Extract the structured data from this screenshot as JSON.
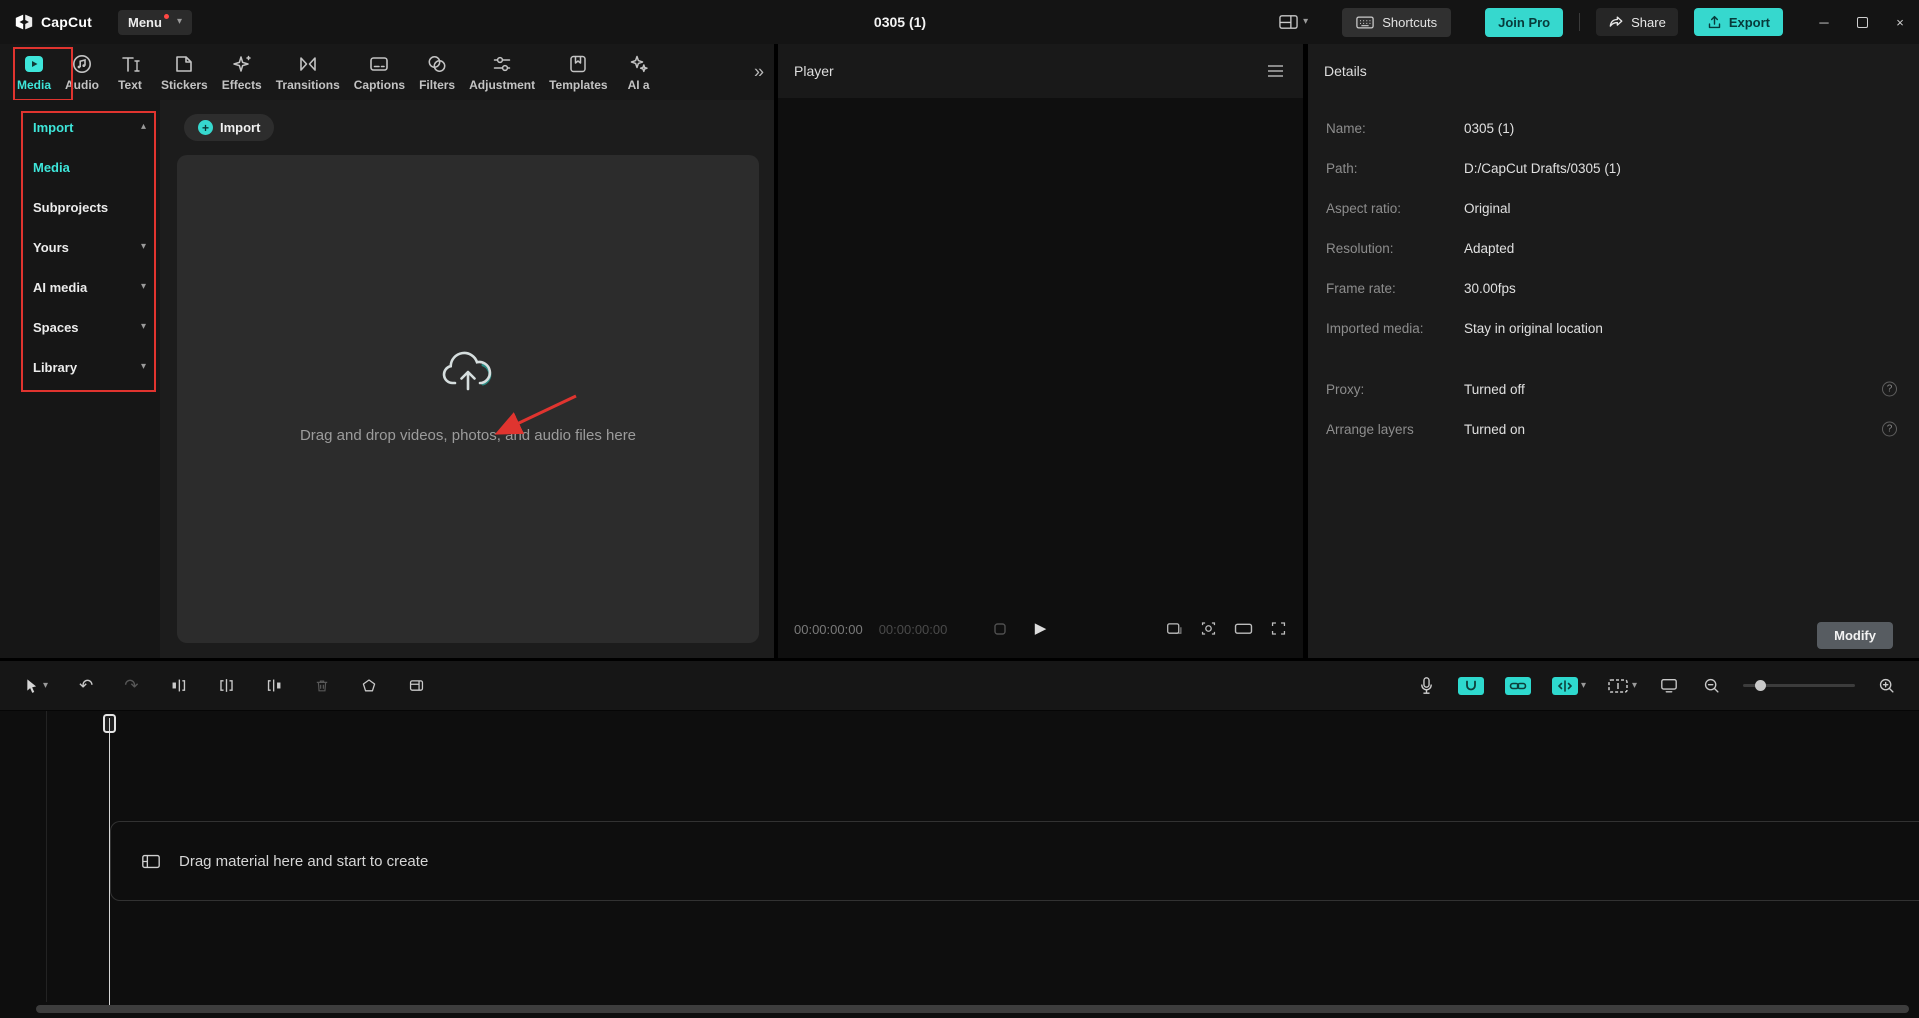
{
  "titlebar": {
    "logo_text": "CapCut",
    "menu_label": "Menu",
    "project_title": "0305 (1)",
    "shortcuts_label": "Shortcuts",
    "join_pro_label": "Join Pro",
    "share_label": "Share",
    "export_label": "Export"
  },
  "media_panel": {
    "tabs": [
      {
        "label": "Media"
      },
      {
        "label": "Audio"
      },
      {
        "label": "Text"
      },
      {
        "label": "Stickers"
      },
      {
        "label": "Effects"
      },
      {
        "label": "Transitions"
      },
      {
        "label": "Captions"
      },
      {
        "label": "Filters"
      },
      {
        "label": "Adjustment"
      },
      {
        "label": "Templates"
      },
      {
        "label": "AI a"
      }
    ],
    "sidebar": {
      "items": [
        {
          "label": "Import",
          "state": "expanded",
          "active": true
        },
        {
          "label": "Media",
          "active": true
        },
        {
          "label": "Subprojects"
        },
        {
          "label": "Yours",
          "state": "collapsed"
        },
        {
          "label": "AI media",
          "state": "collapsed"
        },
        {
          "label": "Spaces",
          "state": "collapsed"
        },
        {
          "label": "Library",
          "state": "collapsed"
        }
      ]
    },
    "import_button_label": "Import",
    "dropzone_hint": "Drag and drop videos, photos, and audio files here"
  },
  "player": {
    "title": "Player",
    "time_current": "00:00:00:00",
    "time_duration": "00:00:00:00"
  },
  "details": {
    "title": "Details",
    "fields": [
      {
        "label": "Name:",
        "value": "0305 (1)"
      },
      {
        "label": "Path:",
        "value": "D:/CapCut Drafts/0305 (1)"
      },
      {
        "label": "Aspect ratio:",
        "value": "Original"
      },
      {
        "label": "Resolution:",
        "value": "Adapted"
      },
      {
        "label": "Frame rate:",
        "value": "30.00fps"
      },
      {
        "label": "Imported media:",
        "value": "Stay in original location"
      },
      {
        "label": "Proxy:",
        "value": "Turned off",
        "help": true
      },
      {
        "label": "Arrange layers",
        "value": "Turned on",
        "help": true
      }
    ],
    "modify_label": "Modify"
  },
  "timeline": {
    "hint": "Drag material here and start to create"
  },
  "icons": {
    "undo": "↶",
    "redo": "↷",
    "caret_down": "▾",
    "caret_up": "▴",
    "chevron_double": "»",
    "minimize": "─",
    "close": "×",
    "help": "?",
    "play": "▶",
    "plus": "+"
  },
  "colors": {
    "accent": "#36d8ce",
    "annotation": "#e0342f"
  }
}
